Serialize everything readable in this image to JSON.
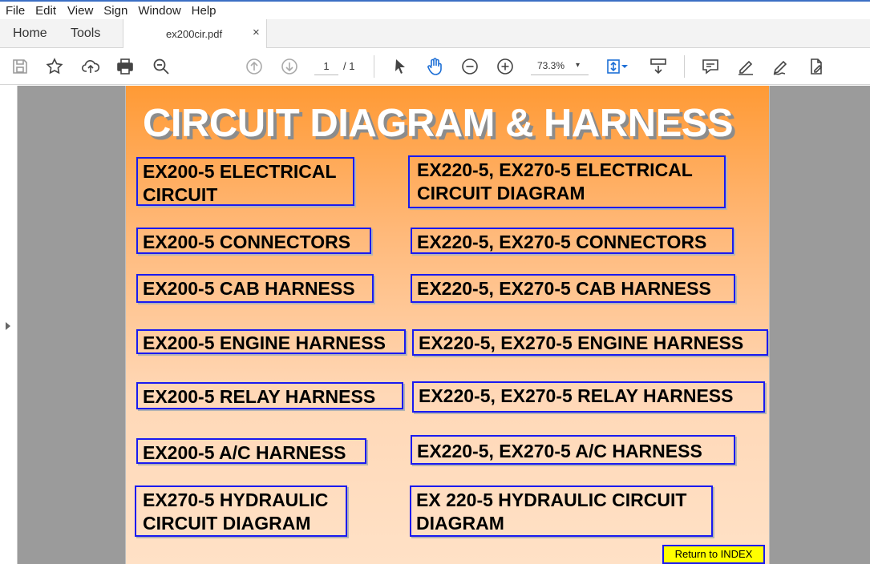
{
  "menu": [
    "File",
    "Edit",
    "View",
    "Sign",
    "Window",
    "Help"
  ],
  "tabs": {
    "home": "Home",
    "tools": "Tools",
    "document": "ex200cir.pdf",
    "close": "×"
  },
  "toolbar": {
    "page_current": "1",
    "page_total": "/ 1",
    "zoom": "73.3%",
    "zoom_arrow": "▾",
    "icons": [
      "save-icon",
      "bookmark-star-icon",
      "upload-cloud-icon",
      "print-icon",
      "zoom-search-icon",
      "page-up-icon",
      "page-down-icon",
      "select-arrow-icon",
      "hand-icon",
      "zoom-out-icon",
      "zoom-in-icon",
      "fit-page-icon",
      "scroll-mode-icon",
      "comment-icon",
      "highlight-pen-icon",
      "sign-icon",
      "fill-sign-icon"
    ]
  },
  "page": {
    "title": "CIRCUIT DIAGRAM & HARNESS",
    "links": [
      {
        "id": "ex200-electrical-circuit",
        "lines": [
          "EX200-5 ELECTRICAL",
          "CIRCUIT"
        ]
      },
      {
        "id": "ex220-270-electrical-circuit",
        "lines": [
          "EX220-5, EX270-5 ELECTRICAL",
          "CIRCUIT DIAGRAM"
        ]
      },
      {
        "id": "ex200-connectors",
        "lines": [
          "EX200-5 CONNECTORS"
        ]
      },
      {
        "id": "ex220-270-connectors",
        "lines": [
          "EX220-5, EX270-5 CONNECTORS"
        ]
      },
      {
        "id": "ex200-cab-harness",
        "lines": [
          "EX200-5 CAB HARNESS"
        ]
      },
      {
        "id": "ex220-270-cab-harness",
        "lines": [
          "EX220-5, EX270-5 CAB HARNESS"
        ]
      },
      {
        "id": "ex200-engine-harness",
        "lines": [
          "EX200-5 ENGINE HARNESS"
        ]
      },
      {
        "id": "ex220-270-engine-harness",
        "lines": [
          "EX220-5, EX270-5 ENGINE HARNESS"
        ]
      },
      {
        "id": "ex200-relay-harness",
        "lines": [
          "EX200-5 RELAY HARNESS"
        ]
      },
      {
        "id": "ex220-270-relay-harness",
        "lines": [
          "EX220-5, EX270-5 RELAY HARNESS"
        ]
      },
      {
        "id": "ex200-ac-harness",
        "lines": [
          "EX200-5 A/C HARNESS"
        ]
      },
      {
        "id": "ex220-270-ac-harness",
        "lines": [
          "EX220-5, EX270-5 A/C HARNESS"
        ]
      },
      {
        "id": "ex270-hydraulic-circuit",
        "lines": [
          "EX270-5 HYDRAULIC",
          "CIRCUIT DIAGRAM"
        ]
      },
      {
        "id": "ex220-hydraulic-circuit",
        "lines": [
          "EX 220-5 HYDRAULIC CIRCUIT",
          "DIAGRAM"
        ]
      }
    ],
    "return_label": "Return to INDEX"
  },
  "colors": {
    "link_border": "#1a1af0",
    "page_top": "#ff9a35",
    "page_bottom": "#ffe1c6",
    "return_bg": "#ffff00",
    "viewer_bg": "#9b9b9b"
  }
}
